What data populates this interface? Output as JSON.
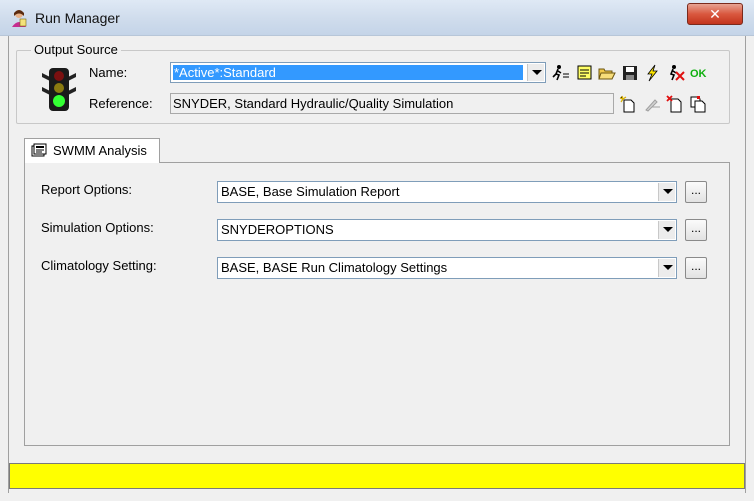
{
  "window": {
    "title": "Run Manager",
    "close_label": "✕"
  },
  "output_source": {
    "legend": "Output Source",
    "name_label": "Name:",
    "name_value": "*Active*:Standard",
    "reference_label": "Reference:",
    "reference_value": "SNYDER, Standard Hydraulic/Quality Simulation"
  },
  "toolbar": {
    "ok_label": "OK"
  },
  "tabs": [
    {
      "label": "SWMM Analysis"
    }
  ],
  "analysis": {
    "report_options_label": "Report Options:",
    "report_options_value": "BASE, Base Simulation Report",
    "simulation_options_label": "Simulation Options:",
    "simulation_options_value": "SNYDEROPTIONS",
    "climatology_label": "Climatology Setting:",
    "climatology_value": "BASE, BASE Run Climatology Settings",
    "browse_label": "..."
  },
  "status": {
    "text": "",
    "color": "#ffff00"
  }
}
